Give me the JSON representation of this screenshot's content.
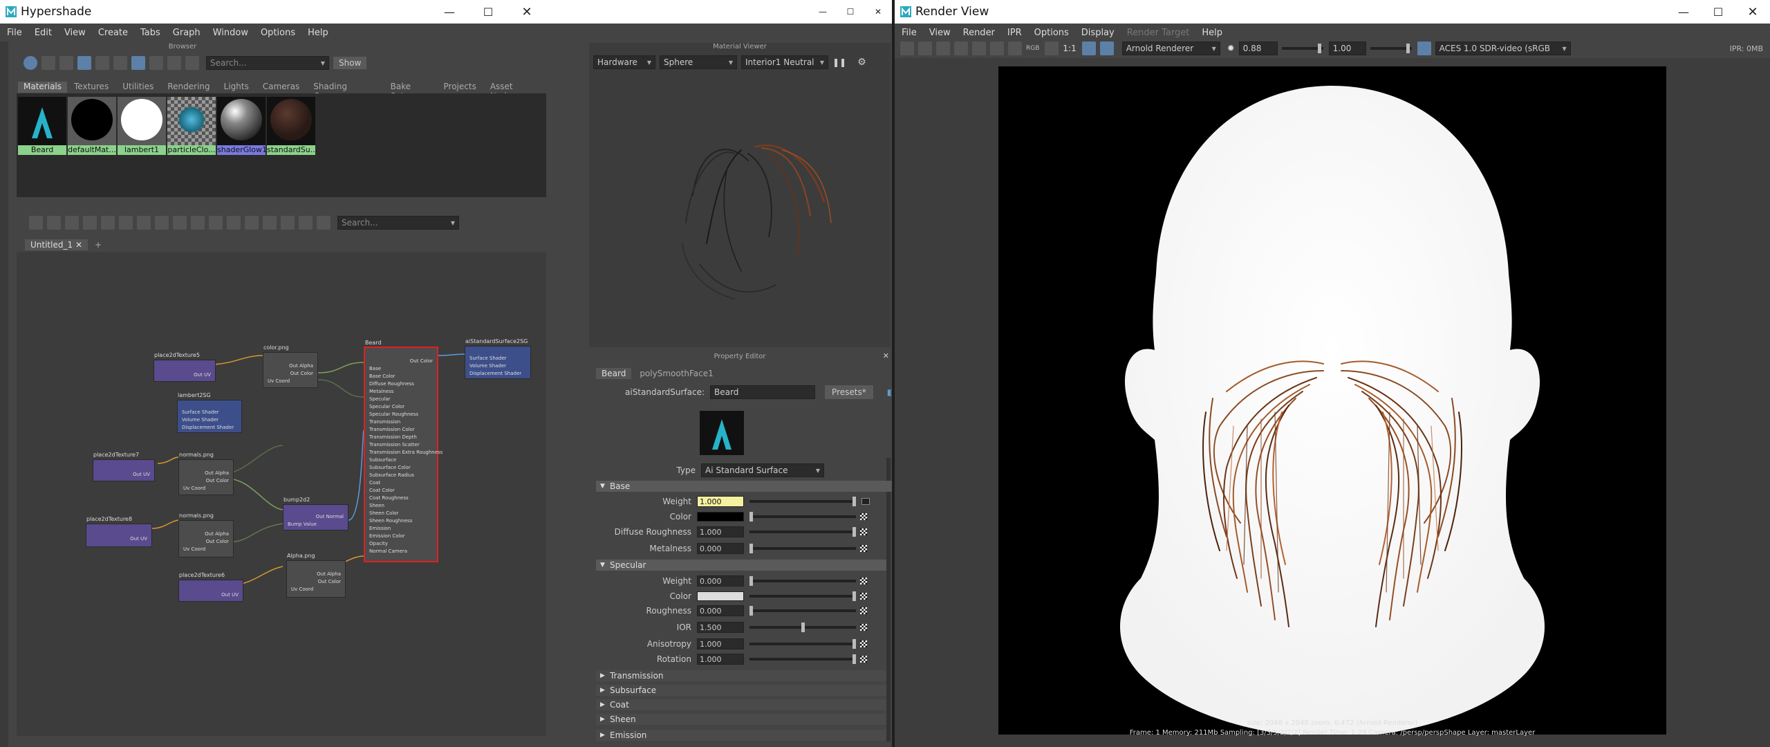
{
  "hypershade": {
    "title": "Hypershade",
    "menu": [
      "File",
      "Edit",
      "View",
      "Create",
      "Tabs",
      "Graph",
      "Window",
      "Options",
      "Help"
    ],
    "browser": {
      "header": "Browser",
      "search_placeholder": "Search...",
      "show_button": "Show",
      "tabs": [
        "Materials",
        "Textures",
        "Utilities",
        "Rendering",
        "Lights",
        "Cameras",
        "Shading Groups",
        "Bake Sets",
        "Projects",
        "Asset Nodes"
      ],
      "swatches": [
        "Beard",
        "defaultMat...",
        "lambert1",
        "particleClo...",
        "shaderGlow1",
        "standardSu..."
      ]
    },
    "graph": {
      "search_placeholder": "Search...",
      "tab": "Untitled_1",
      "add_tab": "+",
      "nodes": {
        "place2dTexture5": {
          "title": "place2dTexture5",
          "attrs": [
            "Out UV"
          ]
        },
        "color": {
          "title": "color.png",
          "attrs": [
            "Out Alpha",
            "Out Color",
            "Uv Coord"
          ]
        },
        "beard": {
          "title": "Beard",
          "attrs": [
            "Out Color",
            "Base",
            "Base Color",
            "Diffuse Roughness",
            "Metalness",
            "Specular",
            "Specular Color",
            "Specular Roughness",
            "Transmission",
            "Transmission Color",
            "Transmission Depth",
            "Transmission Scatter",
            "Transmission Extra Roughness",
            "Subsurface",
            "Subsurface Color",
            "Subsurface Radius",
            "Coat",
            "Coat Color",
            "Coat Roughness",
            "Sheen",
            "Sheen Color",
            "Sheen Roughness",
            "Emission",
            "Emission Color",
            "Opacity",
            "Normal Camera"
          ]
        },
        "aiStandardSurface2SG": {
          "title": "aiStandardSurface2SG",
          "attrs": [
            "Surface Shader",
            "Volume Shader",
            "Displacement Shader"
          ]
        },
        "lambert2SG": {
          "title": "lambert2SG",
          "attrs": [
            "Surface Shader",
            "Volume Shader",
            "Displacement Shader"
          ]
        },
        "place2dTexture7": {
          "title": "place2dTexture7",
          "attrs": [
            "Out UV"
          ]
        },
        "normals1": {
          "title": "normals.png",
          "attrs": [
            "Out Alpha",
            "Out Color",
            "Uv Coord"
          ]
        },
        "bump2d2": {
          "title": "bump2d2",
          "attrs": [
            "Out Normal",
            "Bump Value"
          ]
        },
        "place2dTexture8": {
          "title": "place2dTexture8",
          "attrs": [
            "Out UV"
          ]
        },
        "normals2": {
          "title": "normals.png",
          "attrs": [
            "Out Alpha",
            "Out Color",
            "Uv Coord"
          ]
        },
        "alpha": {
          "title": "Alpha.png",
          "attrs": [
            "Out Alpha",
            "Out Color",
            "Uv Coord"
          ]
        },
        "place2dTexture6": {
          "title": "place2dTexture6",
          "attrs": [
            "Out UV"
          ]
        }
      }
    },
    "material_viewer": {
      "header": "Material Viewer",
      "renderer": "Hardware",
      "shape": "Sphere",
      "env": "Interior1 Neutral"
    },
    "property_editor": {
      "header": "Property Editor",
      "tabs": [
        "Beard",
        "polySmoothFace1"
      ],
      "node_type_label": "aiStandardSurface:",
      "node_name": "Beard",
      "presets": "Presets*",
      "type_label": "Type",
      "type_value": "Ai Standard Surface",
      "sections": {
        "base": "Base",
        "specular": "Specular",
        "collapsed": [
          "Transmission",
          "Subsurface",
          "Coat",
          "Sheen",
          "Emission"
        ]
      },
      "base_attrs": [
        {
          "name": "Weight",
          "value": "1.000",
          "level": 1.0
        },
        {
          "name": "Color",
          "value": "",
          "level": 0.0
        },
        {
          "name": "Diffuse Roughness",
          "value": "1.000",
          "level": 1.0
        },
        {
          "name": "Metalness",
          "value": "0.000",
          "level": 0.0
        }
      ],
      "specular_attrs": [
        {
          "name": "Weight",
          "value": "0.000",
          "level": 0.0
        },
        {
          "name": "Color",
          "value": "",
          "level": 1.0
        },
        {
          "name": "Roughness",
          "value": "0.000",
          "level": 0.0
        },
        {
          "name": "IOR",
          "value": "1.500",
          "level": 0.5
        },
        {
          "name": "Anisotropy",
          "value": "1.000",
          "level": 1.0
        },
        {
          "name": "Rotation",
          "value": "1.000",
          "level": 1.0
        }
      ]
    }
  },
  "render_view": {
    "title": "Render View",
    "menu": [
      "File",
      "View",
      "Render",
      "IPR",
      "Options",
      "Display",
      "Render Target",
      "Help"
    ],
    "renderer": "Arnold Renderer",
    "exposure": "0.88",
    "gamma": "1.00",
    "colorspace": "ACES 1.0 SDR-video (sRGB",
    "ipr": "IPR: 0MB",
    "ratio": "1:1",
    "rgb": "RGB",
    "status_line1": "size: 2048 x 2048 zoom: 0.472   (Arnold Renderer)",
    "status_line2": "Frame: 1     Memory: 211Mb     Sampling: [3/3/5/2/2/2]     Render Time: 1:29     Camera: /persp/perspShape     Layer: masterLayer"
  },
  "colors": {
    "accent_blue": "#5d80a8",
    "material_green": "#8bd28b",
    "selected_purple": "#7a7ae0",
    "node_red_outline": "#e02020",
    "weight_highlight": "#f5f0a0"
  }
}
